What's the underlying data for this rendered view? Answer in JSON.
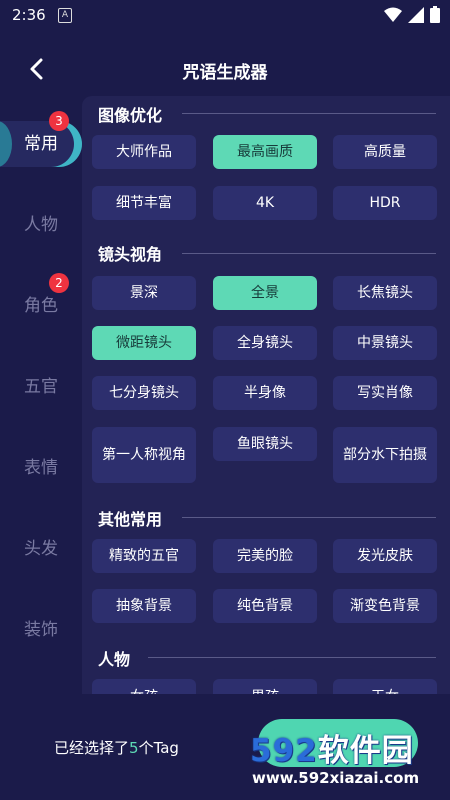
{
  "status_bar": {
    "time": "2:36",
    "notif_letter": "A"
  },
  "header": {
    "title": "咒语生成器"
  },
  "sidebar": {
    "items": [
      {
        "label": "常用",
        "badge": "3"
      },
      {
        "label": "人物",
        "badge": ""
      },
      {
        "label": "角色",
        "badge": "2"
      },
      {
        "label": "五官",
        "badge": ""
      },
      {
        "label": "表情",
        "badge": ""
      },
      {
        "label": "头发",
        "badge": ""
      },
      {
        "label": "装饰",
        "badge": ""
      }
    ]
  },
  "sections": [
    {
      "title": "图像优化",
      "tags": [
        "大师作品",
        "最高画质",
        "高质量",
        "细节丰富",
        "4K",
        "HDR"
      ],
      "selected": [
        "最高画质"
      ]
    },
    {
      "title": "镜头视角",
      "tags": [
        "景深",
        "全景",
        "长焦镜头",
        "微距镜头",
        "全身镜头",
        "中景镜头",
        "七分身镜头",
        "半身像",
        "写实肖像",
        "第一人称视角",
        "鱼眼镜头",
        "部分水下拍摄"
      ],
      "selected": [
        "全景",
        "微距镜头"
      ]
    },
    {
      "title": "其他常用",
      "tags": [
        "精致的五官",
        "完美的脸",
        "发光皮肤",
        "抽象背景",
        "纯色背景",
        "渐变色背景"
      ],
      "selected": []
    },
    {
      "title": "人物",
      "tags": [
        "女孩",
        "男孩",
        "王女"
      ],
      "selected": []
    }
  ],
  "bottom": {
    "count_prefix": "已经选择了",
    "count_num": "5",
    "count_suffix": "个Tag"
  },
  "watermark": {
    "brand_num": "592",
    "brand_text": "软件园",
    "url": "www.592xiazai.com"
  },
  "colors": {
    "background": "#1b1b4a",
    "panel": "#232355",
    "tag": "#2d2f6e",
    "selected": "#5ed9b5",
    "badge": "#ef3340"
  }
}
